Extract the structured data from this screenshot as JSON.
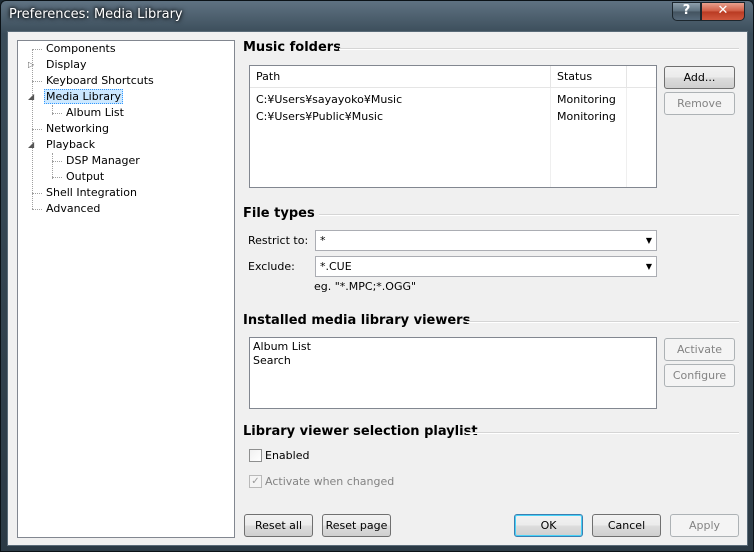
{
  "window": {
    "title": "Preferences: Media Library",
    "help_label": "?",
    "close_label": "✕"
  },
  "tree": {
    "items": [
      {
        "label": "Components"
      },
      {
        "label": "Display"
      },
      {
        "label": "Keyboard Shortcuts"
      },
      {
        "label": "Media Library"
      },
      {
        "label": "Album List"
      },
      {
        "label": "Networking"
      },
      {
        "label": "Playback"
      },
      {
        "label": "DSP Manager"
      },
      {
        "label": "Output"
      },
      {
        "label": "Shell Integration"
      },
      {
        "label": "Advanced"
      }
    ],
    "selected": "Media Library"
  },
  "music_folders": {
    "title": "Music folders",
    "columns": [
      "Path",
      "Status"
    ],
    "rows": [
      {
        "path": "C:¥Users¥sayayoko¥Music",
        "status": "Monitoring"
      },
      {
        "path": "C:¥Users¥Public¥Music",
        "status": "Monitoring"
      }
    ],
    "add_label": "Add...",
    "remove_label": "Remove"
  },
  "file_types": {
    "title": "File types",
    "restrict_label": "Restrict to:",
    "restrict_value": "*",
    "exclude_label": "Exclude:",
    "exclude_value": "*.CUE",
    "hint": "eg. \"*.MPC;*.OGG\""
  },
  "viewers": {
    "title": "Installed media library viewers",
    "items": [
      "Album List",
      "Search"
    ],
    "activate_label": "Activate",
    "configure_label": "Configure"
  },
  "playlist": {
    "title": "Library viewer selection playlist",
    "enabled_label": "Enabled",
    "enabled_checked": false,
    "activate_changed_label": "Activate when changed",
    "activate_changed_checked": true
  },
  "footer": {
    "reset_all": "Reset all",
    "reset_page": "Reset page",
    "ok": "OK",
    "cancel": "Cancel",
    "apply": "Apply"
  },
  "colors": {
    "selection": "#cce8ff",
    "close_button": "#c7442a"
  }
}
